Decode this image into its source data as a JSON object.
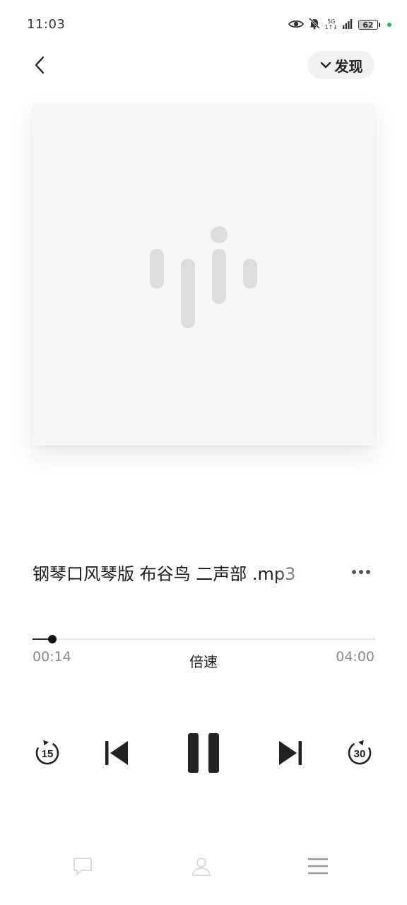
{
  "status_bar": {
    "time": "11:03",
    "network_top": "5G",
    "network_bottom": "1↑↓",
    "battery": "62"
  },
  "header": {
    "back_icon": "chevron-left-icon",
    "discover_label": "发现",
    "discover_icon": "chevron-down-icon"
  },
  "cover": {
    "placeholder_icon": "audio-wave-logo"
  },
  "track": {
    "title": "钢琴口风琴版  布谷鸟  二声部 .mp3",
    "more_icon": "more-horizontal-icon"
  },
  "playback": {
    "elapsed": "00:14",
    "total": "04:00",
    "progress_fraction": 0.058,
    "speed_label": "倍速"
  },
  "controls": {
    "rewind_seconds": "15",
    "forward_seconds": "30"
  },
  "bottom_nav": {
    "items": [
      "comment-icon",
      "user-icon",
      "menu-icon"
    ]
  },
  "colors": {
    "accent_dark": "#1a1a1a",
    "muted_text": "#8a8a8a",
    "status_dot": "#1db954"
  }
}
